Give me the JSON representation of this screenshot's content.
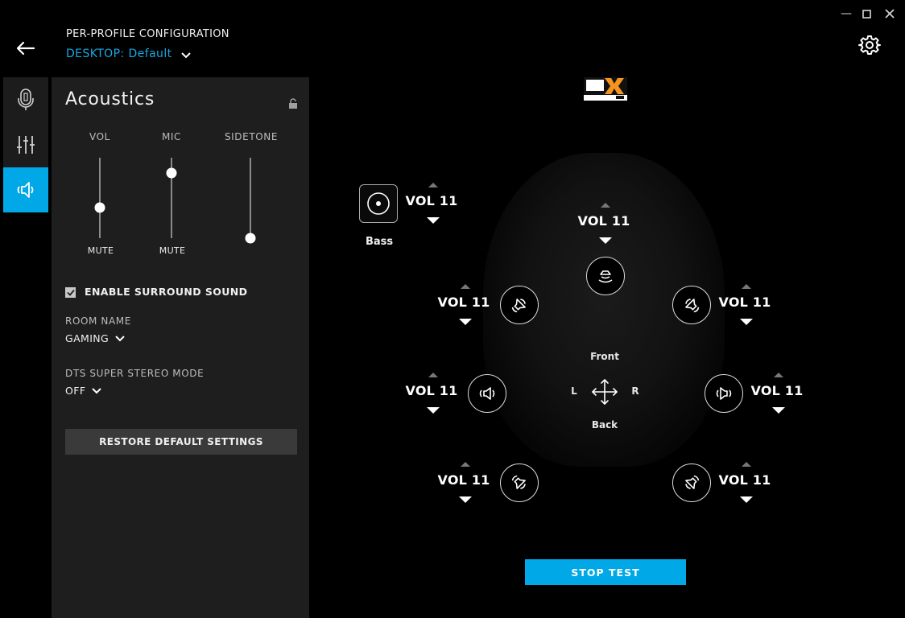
{
  "window": {
    "minimize": "—",
    "maximize": "☐",
    "close": "✕"
  },
  "header": {
    "title": "PER-PROFILE CONFIGURATION",
    "profile_prefix": "DESKTOP:",
    "profile_name": "Default"
  },
  "rail": {
    "items": [
      {
        "name": "microphone",
        "active": false
      },
      {
        "name": "equalizer",
        "active": false
      },
      {
        "name": "acoustics",
        "active": true
      }
    ]
  },
  "panel": {
    "title": "Acoustics",
    "sliders": {
      "vol": {
        "label": "VOL",
        "bottom_label": "MUTE",
        "level": 0.38
      },
      "mic": {
        "label": "MIC",
        "bottom_label": "MUTE",
        "level": 0.81
      },
      "sidetone": {
        "label": "SIDETONE",
        "bottom_label": "",
        "level": 0.0
      }
    },
    "surround": {
      "label": "ENABLE SURROUND SOUND",
      "checked": true
    },
    "room": {
      "label": "ROOM NAME",
      "value": "GAMING"
    },
    "dts_mode": {
      "label": "DTS SUPER STEREO MODE",
      "value": "OFF"
    },
    "restore_label": "RESTORE DEFAULT SETTINGS"
  },
  "mixer": {
    "bass_label": "Bass",
    "channels": {
      "bass": "VOL 11",
      "center": "VOL 11",
      "front_left": "VOL 11",
      "front_right": "VOL 11",
      "side_left": "VOL 11",
      "side_right": "VOL 11",
      "rear_left": "VOL 11",
      "rear_right": "VOL 11"
    },
    "front_label": "Front",
    "back_label": "Back",
    "left_label": "L",
    "right_label": "R"
  },
  "stop_label": "STOP TEST"
}
